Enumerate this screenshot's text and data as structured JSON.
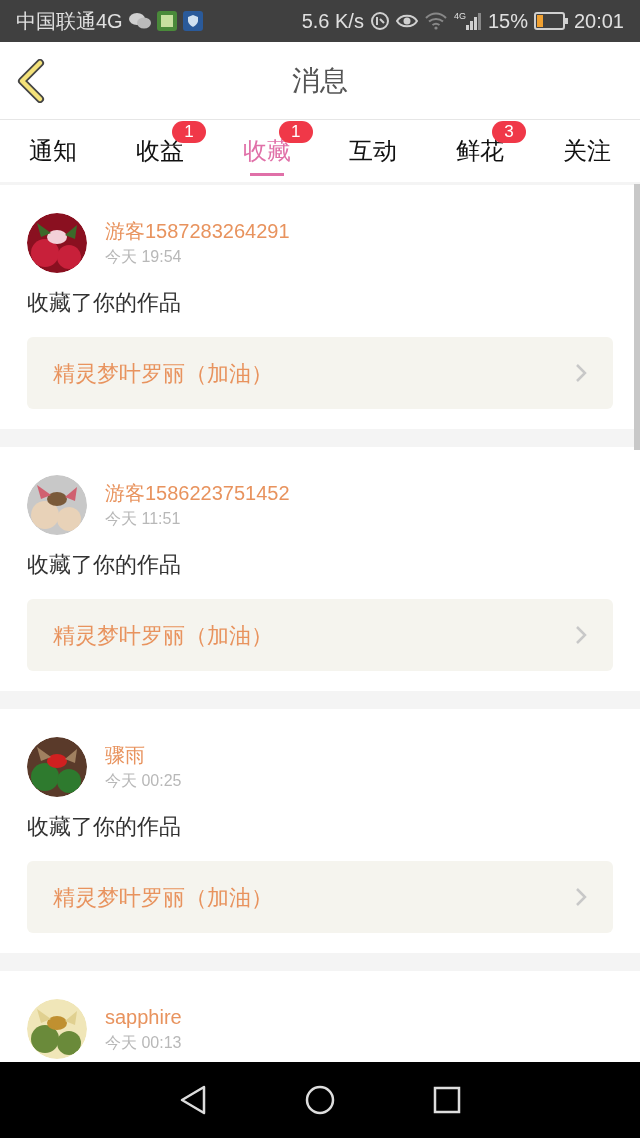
{
  "status_bar": {
    "carrier": "中国联通4G",
    "speed": "5.6 K/s",
    "network": "4G",
    "battery": "15%",
    "time": "20:01"
  },
  "header": {
    "title": "消息"
  },
  "tabs": [
    {
      "label": "通知",
      "selected": false
    },
    {
      "label": "收益",
      "selected": false,
      "badge": "1"
    },
    {
      "label": "收藏",
      "selected": true,
      "badge": "1"
    },
    {
      "label": "互动",
      "selected": false
    },
    {
      "label": "鲜花",
      "selected": false,
      "badge": "3"
    },
    {
      "label": "关注",
      "selected": false
    }
  ],
  "messages": [
    {
      "user": "游客1587283264291",
      "time": "今天 19:54",
      "action": "收藏了你的作品",
      "work": "精灵梦叶罗丽（加油）"
    },
    {
      "user": "游客1586223751452",
      "time": "今天 11:51",
      "action": "收藏了你的作品",
      "work": "精灵梦叶罗丽（加油）"
    },
    {
      "user": "骤雨",
      "time": "今天 00:25",
      "action": "收藏了你的作品",
      "work": "精灵梦叶罗丽（加油）"
    },
    {
      "user": "sapphire",
      "time": "今天 00:13"
    }
  ]
}
